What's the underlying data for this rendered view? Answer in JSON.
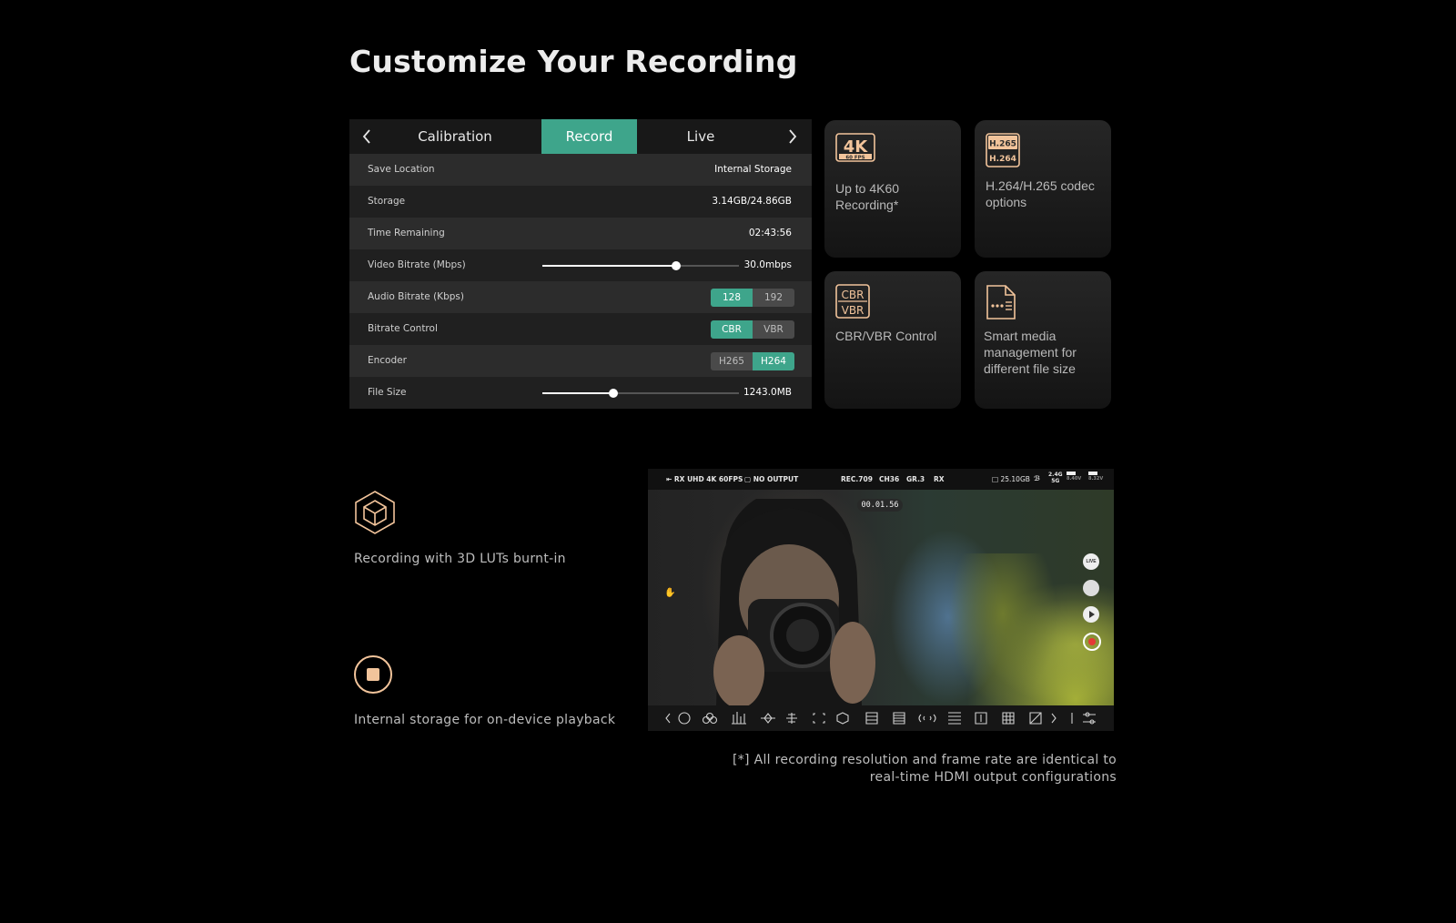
{
  "page": {
    "title": "Customize Your Recording"
  },
  "settings_panel": {
    "tabs": [
      {
        "label": "Calibration",
        "active": false
      },
      {
        "label": "Record",
        "active": true
      },
      {
        "label": "Live",
        "active": false
      }
    ],
    "rows": {
      "save_location": {
        "label": "Save Location",
        "value": "Internal Storage"
      },
      "storage": {
        "label": "Storage",
        "value": "3.14GB/24.86GB"
      },
      "time_remaining": {
        "label": "Time Remaining",
        "value": "02:43:56"
      },
      "video_bitrate": {
        "label": "Video Bitrate (Mbps)",
        "value": "30.0mbps",
        "slider_fraction": 0.68
      },
      "audio_bitrate": {
        "label": "Audio Bitrate (Kbps)",
        "options": [
          "128",
          "192"
        ],
        "selected": "128"
      },
      "bitrate_control": {
        "label": "Bitrate Control",
        "options": [
          "CBR",
          "VBR"
        ],
        "selected": "CBR"
      },
      "encoder": {
        "label": "Encoder",
        "options": [
          "H265",
          "H264"
        ],
        "selected": "H264"
      },
      "file_size": {
        "label": "File Size",
        "value": "1243.0MB",
        "slider_fraction": 0.36
      }
    },
    "accent_color": "#3ea58b"
  },
  "feature_cards": {
    "card_4k": {
      "icon": "4k-60fps-icon",
      "icon_top": "4K",
      "icon_bottom": "60 FPS",
      "text": "Up to 4K60 Recording*"
    },
    "card_codec": {
      "icon": "h265-h264-icon",
      "icon_top": "H.265",
      "icon_bottom": "H.264",
      "text": "H.264/H.265 codec options"
    },
    "card_cbr": {
      "icon": "cbr-vbr-icon",
      "icon_top": "CBR",
      "icon_bottom": "VBR",
      "text": "CBR/VBR Control"
    },
    "card_media": {
      "icon": "media-file-icon",
      "text": "Smart media management for different file size"
    }
  },
  "features": {
    "luts": {
      "icon": "3d-cube-icon",
      "text": "Recording with 3D LUTs burnt-in"
    },
    "storage": {
      "icon": "stop-record-icon",
      "text": "Internal storage for on-device playback"
    }
  },
  "monitor": {
    "rx": "RX UHD 4K 60FPS",
    "output": "NO OUTPUT",
    "rec": "REC.709",
    "ch": "CH36",
    "gr": "GR.3",
    "mode": "RX",
    "storage_small": "25.10GB",
    "band_top": "2.4G",
    "band_bottom": "5G",
    "batt1": "8.40V",
    "batt2": "8.32V",
    "timer": "00.01.56",
    "live_label": "LIVE"
  },
  "footnote": {
    "line1": "[*] All recording resolution and frame rate are identical to",
    "line2": "real-time HDMI output configurations"
  },
  "colors": {
    "icon_peach": "#f2c49b",
    "record_red": "#e53935"
  }
}
